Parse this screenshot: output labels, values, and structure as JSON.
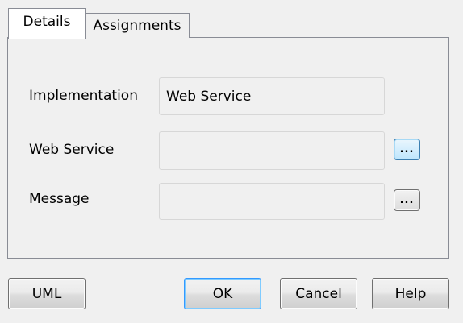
{
  "tabs": [
    {
      "label": "Details",
      "active": true
    },
    {
      "label": "Assignments",
      "active": false
    }
  ],
  "form": {
    "implementation_label": "Implementation",
    "implementation_value": "Web Service",
    "web_service_label": "Web Service",
    "web_service_value": "",
    "message_label": "Message",
    "message_value": "",
    "browse_label": "..."
  },
  "buttons": {
    "uml": "UML",
    "ok": "OK",
    "cancel": "Cancel",
    "help": "Help"
  },
  "colors": {
    "background": "#f0f0f0",
    "focus_accent": "#3399ff"
  }
}
